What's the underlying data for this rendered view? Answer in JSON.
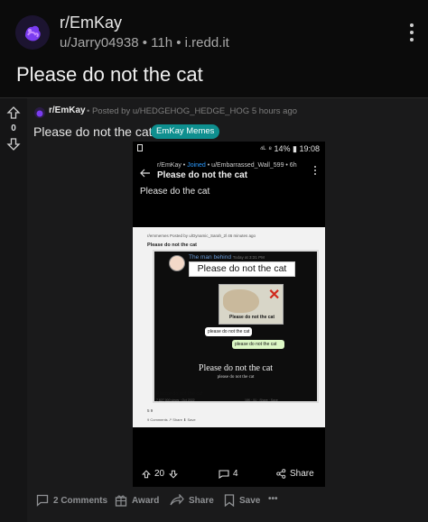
{
  "header": {
    "subreddit": "r/EmKay",
    "post_meta": "u/Jarry04938 • 11h • i.redd.it",
    "title": "Please do not the cat"
  },
  "card": {
    "subreddit": "r/EmKay",
    "meta": "• Posted by u/HEDGEHOG_HEDGE_HOG 5 hours ago",
    "vote_count": "0",
    "title": "Please do not the cat",
    "flair": "EmKay Memes",
    "flair_color": "#0e8f8f"
  },
  "screenshot": {
    "status_right": "⁴ᴸ ⁸ 14% ▮ 19:08",
    "meta_sub": "r/EmKay •",
    "meta_joined": "Joined",
    "meta_user": "• u/Embarrassed_Wall_599 • 6h",
    "title": "Please do not the cat",
    "body": "Please do the cat",
    "tiny_meta": "r/emmemes   Posted by u/Dynamic_Sarah_2l 46 minutes ago",
    "tiny_title": "Please do not the cat",
    "man_name": "The man behind",
    "man_time": "Today at 3:31 PM",
    "white_box_text": "Please do not the cat",
    "meme_caption": "Please do not the cat",
    "bubble_left": "please do not the cat",
    "bubble_right": "please do not the cat",
    "big_caption": "Please do not the cat",
    "small_caption": "please do not the cat",
    "caption": "Please do not the cat",
    "caption_meta": "7,827,000 views · Oct 2022",
    "caption_stats": "18K  ·  51  ·  Share  ·  Save",
    "awards": "5  9",
    "comments": "9 Comments   ↗ Share   ⬇ Save",
    "actions": {
      "votes": "20",
      "comments": "4",
      "share": "Share"
    }
  },
  "bottom_bar": {
    "comments": "2 Comments",
    "award": "Award",
    "share": "Share",
    "save": "Save",
    "more": "•••"
  }
}
